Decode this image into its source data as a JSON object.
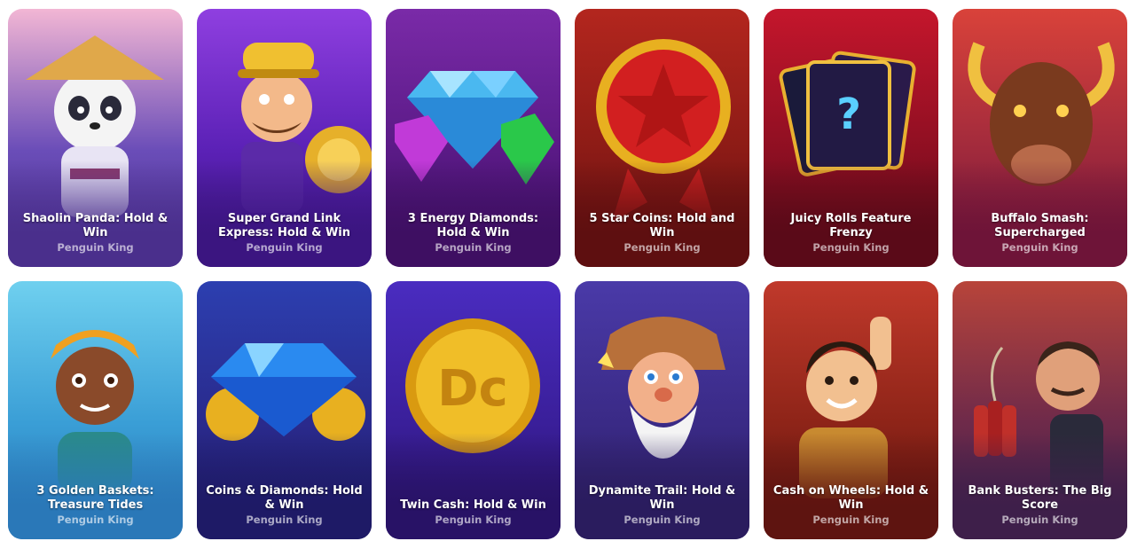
{
  "games": [
    {
      "title": "Shaolin Panda: Hold & Win",
      "provider": "Penguin King",
      "icon": "panda-monk-icon",
      "colors": [
        "#f2b6d4",
        "#6a4db8",
        "#4a2f8c"
      ]
    },
    {
      "title": "Super Grand Link Express: Hold & Win",
      "provider": "Penguin King",
      "icon": "train-conductor-icon",
      "colors": [
        "#8f3fe0",
        "#5b21b6",
        "#3b1580"
      ]
    },
    {
      "title": "3 Energy Diamonds: Hold & Win",
      "provider": "Penguin King",
      "icon": "diamonds-icon",
      "colors": [
        "#7a2aa8",
        "#5a1a86",
        "#3e0f62"
      ]
    },
    {
      "title": "5 Star Coins: Hold and Win",
      "provider": "Penguin King",
      "icon": "star-coin-icon",
      "colors": [
        "#b3261e",
        "#8c1b16",
        "#5e0f10"
      ]
    },
    {
      "title": "Juicy Rolls Feature Frenzy",
      "provider": "Penguin King",
      "icon": "mystery-cards-icon",
      "colors": [
        "#c4162c",
        "#8e0f22",
        "#5a0a18"
      ]
    },
    {
      "title": "Buffalo Smash: Supercharged",
      "provider": "Penguin King",
      "icon": "buffalo-icon",
      "colors": [
        "#d9423a",
        "#a12a3c",
        "#6e1438"
      ]
    },
    {
      "title": "3 Golden Baskets: Treasure Tides",
      "provider": "Penguin King",
      "icon": "girl-character-icon",
      "colors": [
        "#6fd0ef",
        "#3a9ed6",
        "#2a78b8"
      ]
    },
    {
      "title": "Coins & Diamonds: Hold & Win",
      "provider": "Penguin King",
      "icon": "blue-diamond-icon",
      "colors": [
        "#2c3fb0",
        "#2a2a8c",
        "#1e1a66"
      ]
    },
    {
      "title": "Twin Cash: Hold & Win",
      "provider": "Penguin King",
      "icon": "dc-coin-icon",
      "colors": [
        "#4a2cc0",
        "#3a1f9a",
        "#281266"
      ]
    },
    {
      "title": "Dynamite Trail: Hold & Win",
      "provider": "Penguin King",
      "icon": "miner-icon",
      "colors": [
        "#4a3aa8",
        "#3a2a86",
        "#2a1c5e"
      ]
    },
    {
      "title": "Cash on Wheels: Hold & Win",
      "provider": "Penguin King",
      "icon": "driver-icon",
      "colors": [
        "#c0392b",
        "#8e2418",
        "#5e1410"
      ]
    },
    {
      "title": "Bank Busters: The Big Score",
      "provider": "Penguin King",
      "icon": "dynamite-man-icon",
      "colors": [
        "#b8443a",
        "#6e2a4a",
        "#3e1f4a"
      ]
    }
  ]
}
